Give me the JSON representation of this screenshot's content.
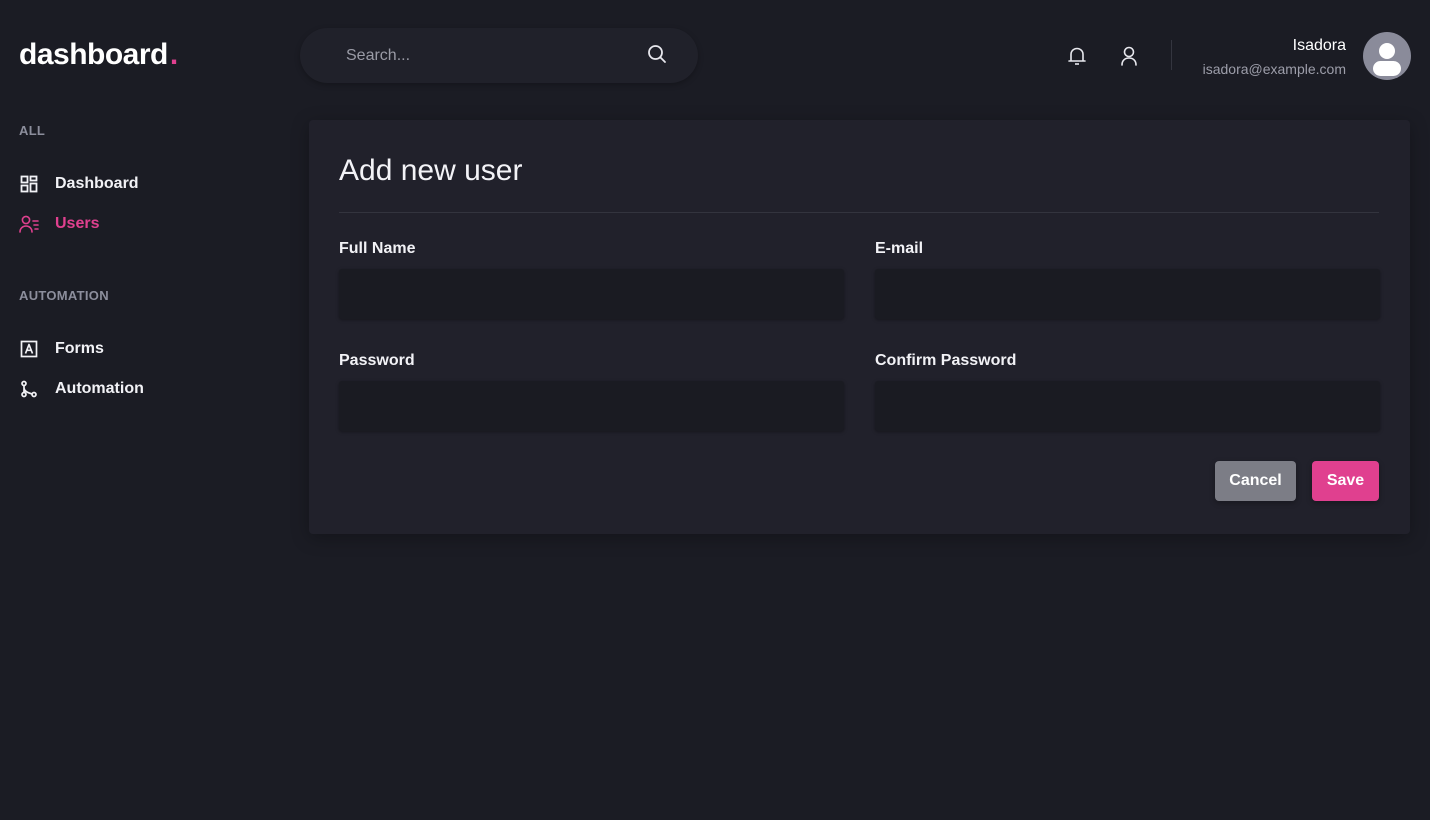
{
  "brand": {
    "name": "dashboard",
    "dot": ".",
    "accent": "#e0408f"
  },
  "sidebar": {
    "sections": [
      {
        "label": "ALL"
      },
      {
        "label": "AUTOMATION"
      }
    ],
    "items": [
      {
        "label": "Dashboard",
        "icon": "grid-icon",
        "active": false
      },
      {
        "label": "Users",
        "icon": "users-icon",
        "active": true
      },
      {
        "label": "Forms",
        "icon": "form-icon",
        "active": false
      },
      {
        "label": "Automation",
        "icon": "flow-icon",
        "active": false
      }
    ]
  },
  "header": {
    "search": {
      "placeholder": "Search...",
      "value": ""
    },
    "icons": [
      "bell-icon",
      "user-icon"
    ],
    "user": {
      "name": "Isadora",
      "email": "isadora@example.com"
    }
  },
  "form": {
    "title": "Add new user",
    "fields": [
      {
        "label": "Full Name",
        "value": ""
      },
      {
        "label": "E-mail",
        "value": ""
      },
      {
        "label": "Password",
        "value": ""
      },
      {
        "label": "Confirm Password",
        "value": ""
      }
    ],
    "cancel_label": "Cancel",
    "save_label": "Save"
  },
  "colors": {
    "background": "#1b1c24",
    "card": "#21212b",
    "input": "#1a1b22",
    "accent": "#e0408f",
    "cancel": "#7c7d86"
  }
}
